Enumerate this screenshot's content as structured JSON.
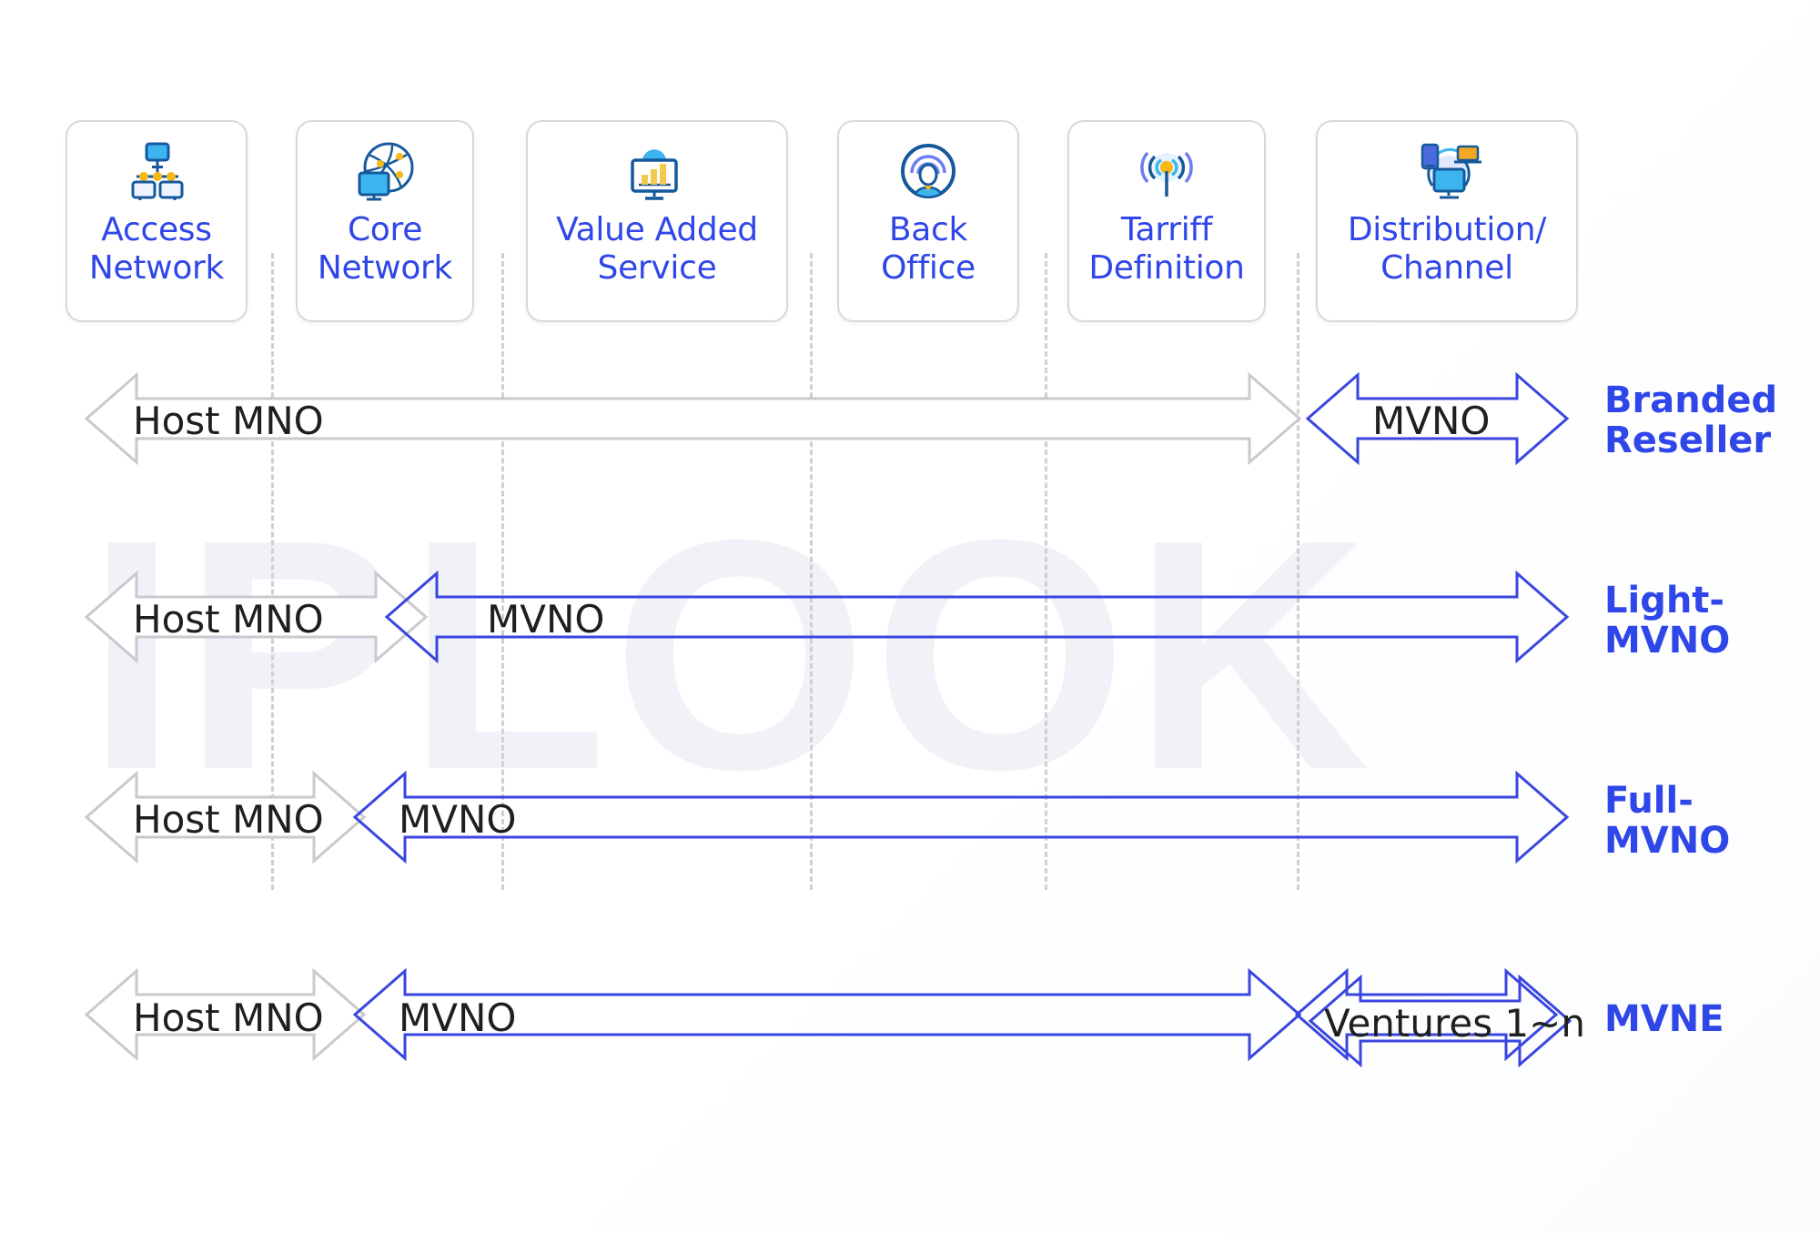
{
  "watermark": "IPLOOK",
  "colors": {
    "accent_blue": "#2f46e8",
    "arrow_blue": "#3a46df",
    "arrow_gray": "#c9c9cf",
    "card_border": "#d8d8dc",
    "divider": "#cfcfd4",
    "label_text": "#1f1f1f",
    "icon_dark_blue": "#15599c",
    "icon_light_blue": "#3cb4f0",
    "icon_yellow": "#f6b817",
    "icon_periwinkle": "#6e7bf2"
  },
  "cards": [
    {
      "icon": "access-network-icon",
      "label": "Access\nNetwork"
    },
    {
      "icon": "core-network-icon",
      "label": "Core\nNetwork"
    },
    {
      "icon": "value-added-service-icon",
      "label": "Value Added\nService"
    },
    {
      "icon": "back-office-icon",
      "label": "Back\nOffice"
    },
    {
      "icon": "tarriff-definition-icon",
      "label": "Tarriff\nDefinition"
    },
    {
      "icon": "distribution-channel-icon",
      "label": "Distribution/\nChannel"
    }
  ],
  "rows": [
    {
      "name": "branded-reseller",
      "label": "Branded\nReseller",
      "segments": [
        {
          "name": "host-mno",
          "text": "Host MNO",
          "color": "gray"
        },
        {
          "name": "mvno",
          "text": "MVNO",
          "color": "blue"
        }
      ]
    },
    {
      "name": "light-mvno",
      "label": "Light-\nMVNO",
      "segments": [
        {
          "name": "host-mno",
          "text": "Host MNO",
          "color": "gray"
        },
        {
          "name": "mvno",
          "text": "MVNO",
          "color": "blue"
        }
      ]
    },
    {
      "name": "full-mvno",
      "label": "Full-\nMVNO",
      "segments": [
        {
          "name": "host-mno",
          "text": "Host MNO",
          "color": "gray"
        },
        {
          "name": "mvno",
          "text": "MVNO",
          "color": "blue"
        }
      ]
    },
    {
      "name": "mvne",
      "label": "MVNE",
      "segments": [
        {
          "name": "host-mno",
          "text": "Host MNO",
          "color": "gray"
        },
        {
          "name": "mvno",
          "text": "MVNO",
          "color": "blue"
        },
        {
          "name": "ventures",
          "text": "Ventures 1~n",
          "color": "blue"
        }
      ]
    }
  ]
}
